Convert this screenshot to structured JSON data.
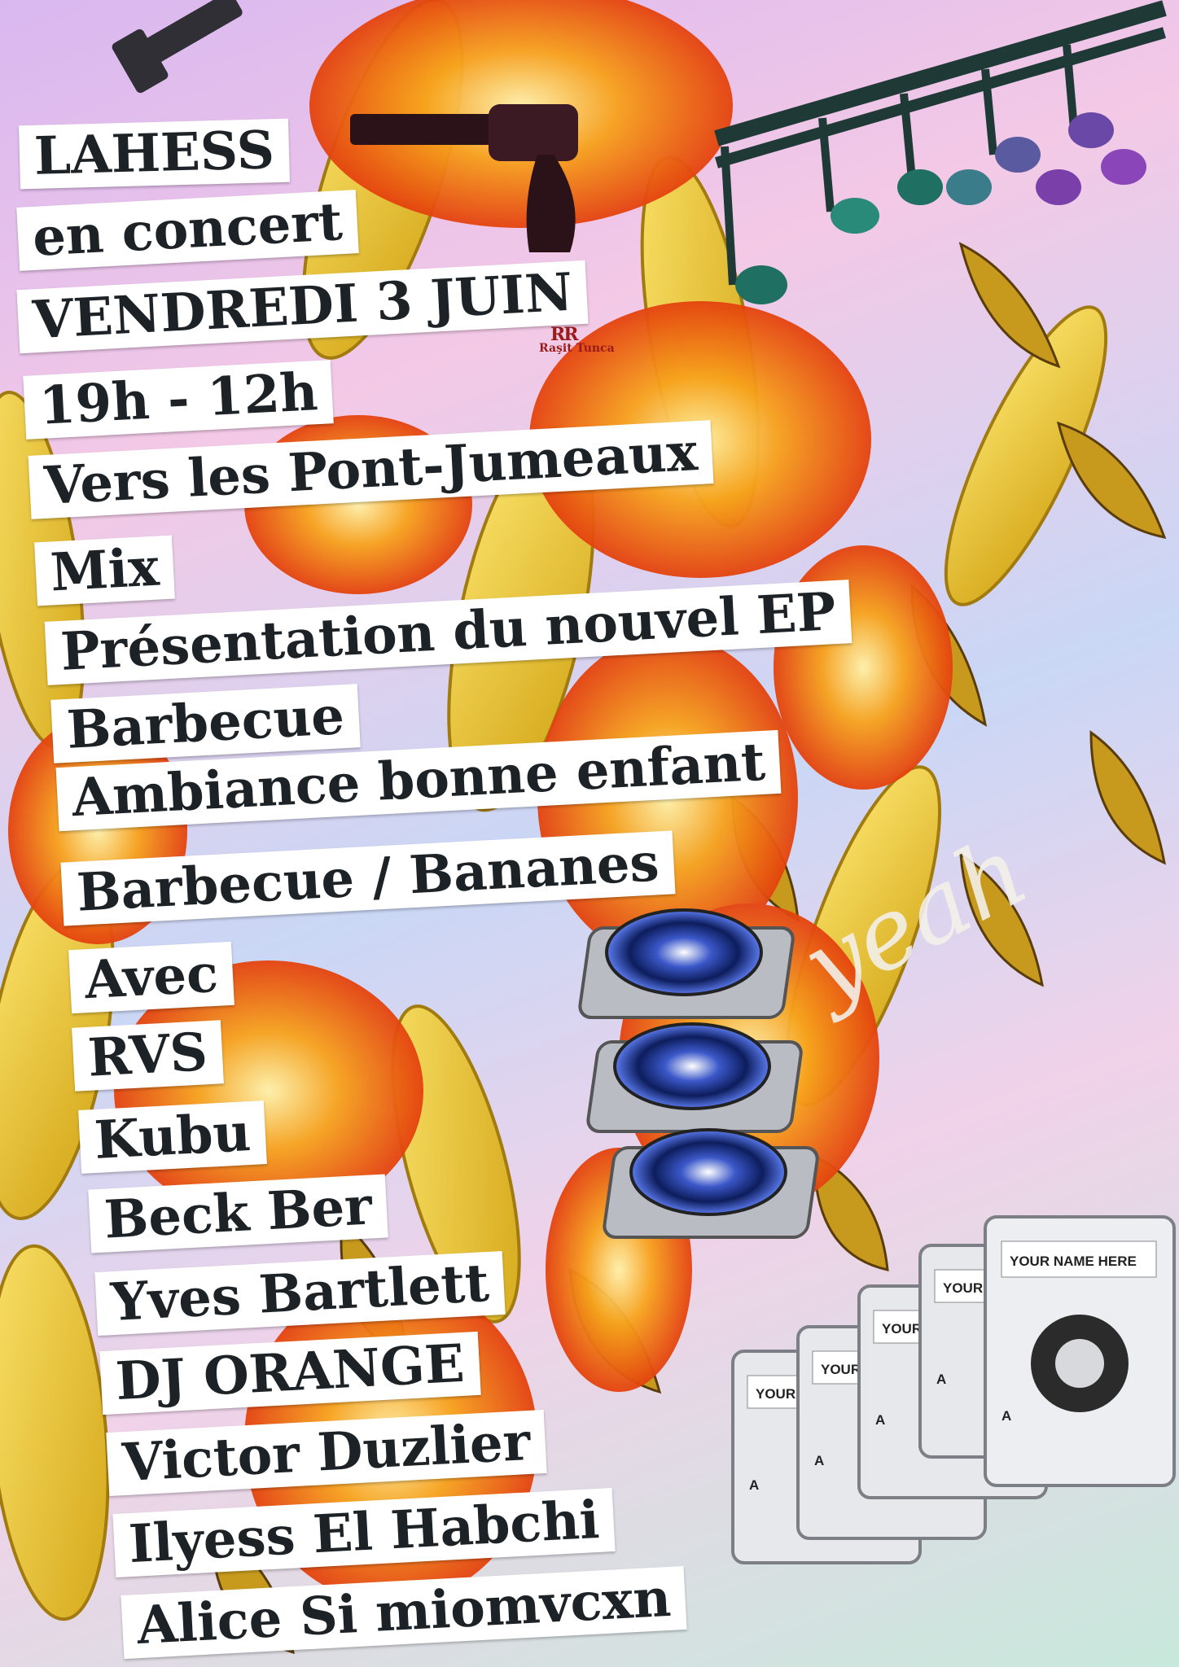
{
  "lines": [
    "LAHESS",
    "en concert",
    "VENDREDI 3 JUIN",
    "19h - 12h",
    "Vers les Pont-Jumeaux",
    "Mix",
    "Présentation du nouvel EP",
    "Barbecue",
    "Ambiance bonne enfant",
    "Barbecue / Bananes",
    "Avec",
    "RVS",
    "Kubu",
    "Beck Ber",
    "Yves Bartlett",
    "DJ ORANGE",
    "Victor Duzlier",
    "Ilyess El Habchi",
    "Alice Si miomvcxn"
  ],
  "watermark": {
    "monogram": "RR",
    "name": "Raşit Tunca"
  },
  "script_word": "yeah",
  "cassette_labels": [
    "YOUR NAME HERE",
    "YOUR",
    "YOUR",
    "YOUR",
    "YOUR"
  ],
  "cassette_side": "A",
  "colors": {
    "flame": "#f26a12",
    "banana": "#f1d43a",
    "note_teal": "#1f6f63",
    "note_purple": "#7a3fa8"
  }
}
